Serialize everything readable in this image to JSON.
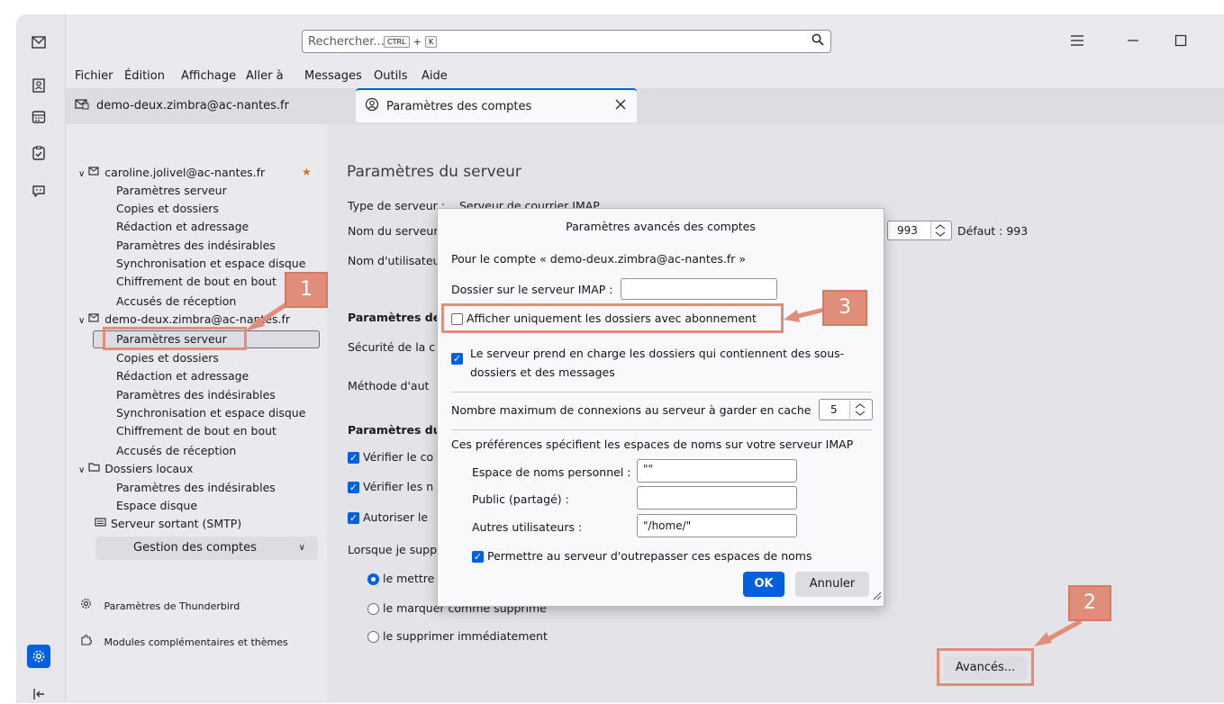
{
  "window": {
    "search_placeholder": "Rechercher...",
    "kbd_ctrl": "CTRL",
    "kbd_plus": "+",
    "kbd_k": "K"
  },
  "menu": [
    "Fichier",
    "Édition",
    "Affichage",
    "Aller à",
    "Messages",
    "Outils",
    "Aide"
  ],
  "tabs": {
    "mail": "demo-deux.zimbra@ac-nantes.fr",
    "settings": "Paramètres des comptes"
  },
  "sidebar": {
    "account1": "caroline.jolivel@ac-nantes.fr",
    "account1_items": [
      "Paramètres serveur",
      "Copies et dossiers",
      "Rédaction et adressage",
      "Paramètres des indésirables",
      "Synchronisation et espace disque",
      "Chiffrement de bout en bout",
      "Accusés de réception"
    ],
    "account2": "demo-deux.zimbra@ac-nantes.fr",
    "account2_items": [
      "Paramètres serveur",
      "Copies et dossiers",
      "Rédaction et adressage",
      "Paramètres des indésirables",
      "Synchronisation et espace disque",
      "Chiffrement de bout en bout",
      "Accusés de réception"
    ],
    "local": "Dossiers locaux",
    "local_items": [
      "Paramètres des indésirables",
      "Espace disque"
    ],
    "smtp": "Serveur sortant (SMTP)",
    "manage": "Gestion des comptes",
    "tb_settings": "Paramètres de Thunderbird",
    "addons": "Modules complémentaires et thèmes"
  },
  "main": {
    "title": "Paramètres du serveur",
    "server_type_label": "Type de serveur :",
    "server_type_value": "Serveur de courrier IMAP",
    "server_name_label": "Nom du serveur",
    "username_label": "Nom d'utilisateur",
    "port": "993",
    "default_port": "Défaut : 993",
    "security_heading": "Paramètres de",
    "security_label": "Sécurité de la c",
    "auth_label": "Méthode d'aut",
    "server_heading": "Paramètres du",
    "check1": "Vérifier le co",
    "check2": "Vérifier les n",
    "check3": "Autoriser le",
    "delete_label": "Lorsque je supp",
    "radio1": "le mettre",
    "radio2": "le marquer comme supprimé",
    "radio3": "le supprimer immédiatement",
    "advanced_button": "Avancés..."
  },
  "dialog": {
    "title": "Paramètres avancés des comptes",
    "account_line": "Pour le compte « demo-deux.zimbra@ac-nantes.fr »",
    "imap_folder_label": "Dossier sur le serveur IMAP :",
    "imap_folder_value": "",
    "subscribed_only": "Afficher uniquement les dossiers avec abonnement",
    "subfolders_line1": "Le serveur prend en charge les dossiers qui contiennent des sous-",
    "subfolders_line2": "dossiers et des messages",
    "max_connections_label": "Nombre maximum de connexions au serveur à garder en cache",
    "max_connections_value": "5",
    "namespaces_intro": "Ces préférences spécifient les espaces de noms sur votre serveur IMAP",
    "personal_label": "Espace de noms personnel :",
    "personal_value": "\"\"",
    "public_label": "Public (partagé) :",
    "public_value": "",
    "others_label": "Autres utilisateurs :",
    "others_value": "\"/home/\"",
    "override_label": "Permettre au serveur d'outrepasser ces espaces de noms",
    "ok": "OK",
    "cancel": "Annuler"
  },
  "callouts": [
    "1",
    "2",
    "3"
  ],
  "colors": {
    "accent": "#0060df",
    "callout": "#e08e79"
  }
}
